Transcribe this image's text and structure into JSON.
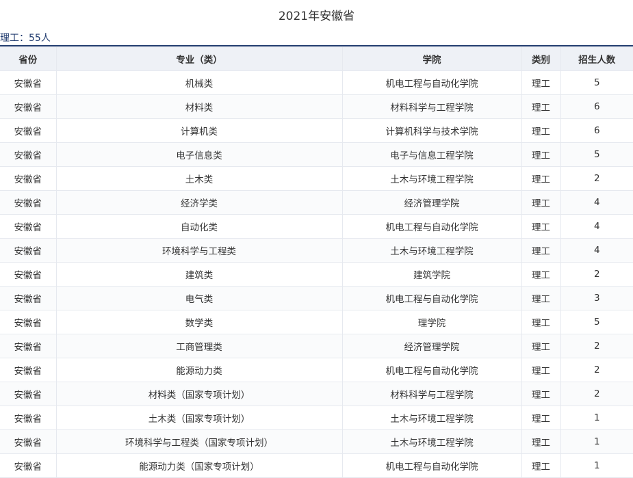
{
  "page_title": "2021年安徽省",
  "summary": "理工：55人",
  "table": {
    "headers": [
      "省份",
      "专业（类）",
      "学院",
      "类别",
      "招生人数"
    ],
    "rows": [
      [
        "安徽省",
        "机械类",
        "机电工程与自动化学院",
        "理工",
        "5"
      ],
      [
        "安徽省",
        "材料类",
        "材料科学与工程学院",
        "理工",
        "6"
      ],
      [
        "安徽省",
        "计算机类",
        "计算机科学与技术学院",
        "理工",
        "6"
      ],
      [
        "安徽省",
        "电子信息类",
        "电子与信息工程学院",
        "理工",
        "5"
      ],
      [
        "安徽省",
        "土木类",
        "土木与环境工程学院",
        "理工",
        "2"
      ],
      [
        "安徽省",
        "经济学类",
        "经济管理学院",
        "理工",
        "4"
      ],
      [
        "安徽省",
        "自动化类",
        "机电工程与自动化学院",
        "理工",
        "4"
      ],
      [
        "安徽省",
        "环境科学与工程类",
        "土木与环境工程学院",
        "理工",
        "4"
      ],
      [
        "安徽省",
        "建筑类",
        "建筑学院",
        "理工",
        "2"
      ],
      [
        "安徽省",
        "电气类",
        "机电工程与自动化学院",
        "理工",
        "3"
      ],
      [
        "安徽省",
        "数学类",
        "理学院",
        "理工",
        "5"
      ],
      [
        "安徽省",
        "工商管理类",
        "经济管理学院",
        "理工",
        "2"
      ],
      [
        "安徽省",
        "能源动力类",
        "机电工程与自动化学院",
        "理工",
        "2"
      ],
      [
        "安徽省",
        "材料类（国家专项计划）",
        "材料科学与工程学院",
        "理工",
        "2"
      ],
      [
        "安徽省",
        "土木类（国家专项计划）",
        "土木与环境工程学院",
        "理工",
        "1"
      ],
      [
        "安徽省",
        "环境科学与工程类（国家专项计划）",
        "土木与环境工程学院",
        "理工",
        "1"
      ],
      [
        "安徽省",
        "能源动力类（国家专项计划）",
        "机电工程与自动化学院",
        "理工",
        "1"
      ]
    ]
  }
}
